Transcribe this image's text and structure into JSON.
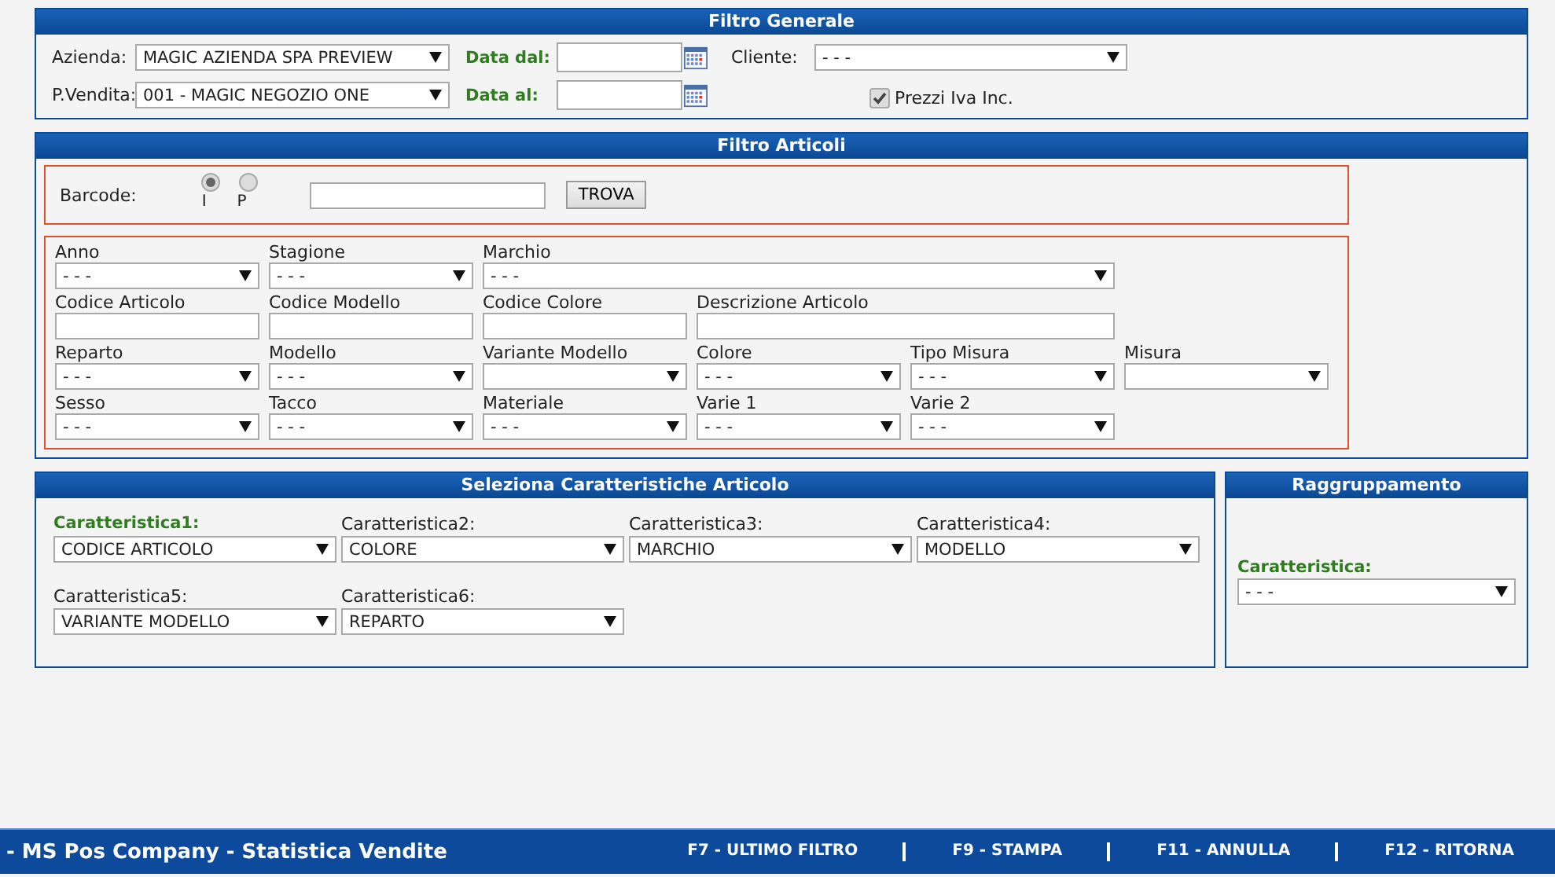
{
  "filtro_generale": {
    "title": "Filtro Generale",
    "azienda": {
      "label": "Azienda:",
      "value": "MAGIC AZIENDA SPA PREVIEW"
    },
    "data_dal": {
      "label": "Data dal:"
    },
    "cliente": {
      "label": "Cliente:",
      "value": "- - -"
    },
    "punto_vendita": {
      "label": "P.Vendita:",
      "value": "001 - MAGIC NEGOZIO ONE"
    },
    "data_al": {
      "label": "Data al:"
    },
    "prezzi_iva": {
      "label": "Prezzi Iva Inc.",
      "checked": true
    }
  },
  "filtro_articoli": {
    "title": "Filtro Articoli",
    "barcode": {
      "label": "Barcode:",
      "options": [
        {
          "label": "I",
          "selected": true
        },
        {
          "label": "P",
          "selected": false
        }
      ],
      "button": "TROVA"
    },
    "rows": [
      [
        {
          "label": "Anno",
          "kind": "select",
          "value": "- - -"
        },
        {
          "label": "Stagione",
          "kind": "select",
          "value": "- - -"
        },
        {
          "label": "Marchio",
          "kind": "select",
          "value": "- - -"
        }
      ],
      [
        {
          "label": "Codice Articolo",
          "kind": "text"
        },
        {
          "label": "Codice Modello",
          "kind": "text"
        },
        {
          "label": "Codice Colore",
          "kind": "text"
        },
        {
          "label": "Descrizione Articolo",
          "kind": "text"
        }
      ],
      [
        {
          "label": "Reparto",
          "kind": "select",
          "value": "- - -"
        },
        {
          "label": "Modello",
          "kind": "select",
          "value": "- - -"
        },
        {
          "label": "Variante Modello",
          "kind": "select"
        },
        {
          "label": "Colore",
          "kind": "select",
          "value": "- - -"
        },
        {
          "label": "Tipo Misura",
          "kind": "select",
          "value": "- - -"
        },
        {
          "label": "Misura",
          "kind": "select"
        }
      ],
      [
        {
          "label": "Sesso",
          "kind": "select",
          "value": "- - -"
        },
        {
          "label": "Tacco",
          "kind": "select",
          "value": "- - -"
        },
        {
          "label": "Materiale",
          "kind": "select",
          "value": "- - -"
        },
        {
          "label": "Varie 1",
          "kind": "select",
          "value": "- - -"
        },
        {
          "label": "Varie 2",
          "kind": "select",
          "value": "- - -"
        }
      ]
    ]
  },
  "caratteristiche": {
    "title": "Seleziona Caratteristiche Articolo",
    "items": [
      {
        "label": "Caratteristica1:",
        "value": "CODICE ARTICOLO",
        "required": true
      },
      {
        "label": "Caratteristica2:",
        "value": "COLORE",
        "required": false
      },
      {
        "label": "Caratteristica3:",
        "value": "MARCHIO",
        "required": false
      },
      {
        "label": "Caratteristica4:",
        "value": "MODELLO",
        "required": false
      },
      {
        "label": "Caratteristica5:",
        "value": "VARIANTE MODELLO",
        "required": false
      },
      {
        "label": "Caratteristica6:",
        "value": "REPARTO",
        "required": false
      }
    ]
  },
  "raggruppamento": {
    "title": "Raggruppamento",
    "label": "Caratteristica:",
    "value": "- - -",
    "required": true
  },
  "footer": {
    "title": "- MS Pos Company - Statistica Vendite",
    "actions": [
      "F7 - ULTIMO FILTRO",
      "F9 - STAMPA",
      "F11 - ANNULLA",
      "F12 - RITORNA"
    ]
  }
}
